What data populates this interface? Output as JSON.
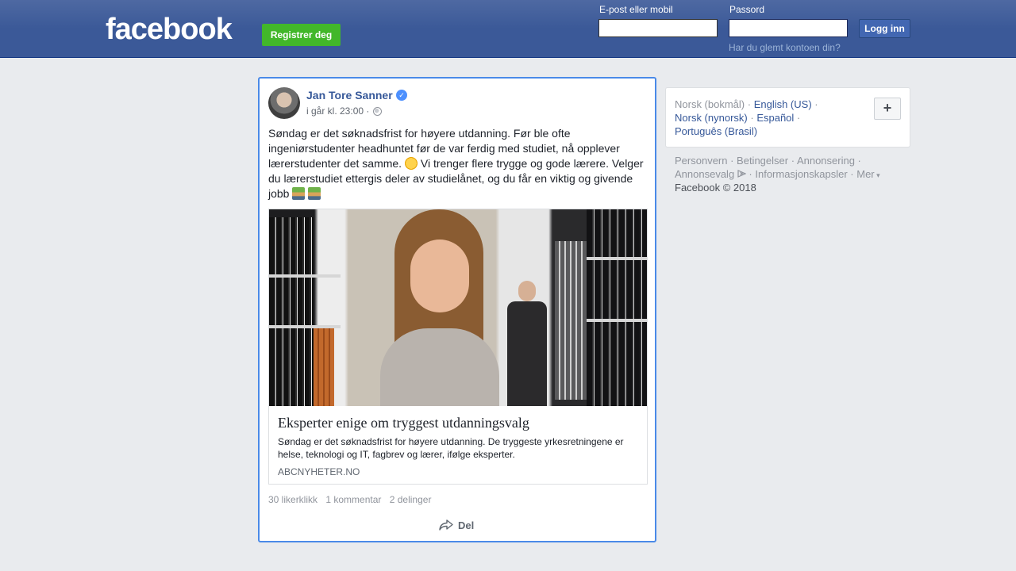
{
  "header": {
    "logo": "facebook",
    "register_label": "Registrer deg",
    "email_label": "E-post eller mobil",
    "password_label": "Passord",
    "login_label": "Logg inn",
    "forgot_label": "Har du glemt kontoen din?",
    "email_value": "",
    "password_value": ""
  },
  "post": {
    "author": "Jan Tore Sanner",
    "time": "i går kl. 23:00 ·",
    "text_part1": "Søndag er det søknadsfrist for høyere utdanning. Før ble ofte ingeniørstudenter headhuntet før de var ferdig med studiet, nå opplever lærerstudenter det samme.",
    "text_part2": "Vi trenger flere trygge og gode lærere. Velger du lærerstudiet ettergis deler av studielånet, og du får en viktig og givende jobb",
    "link": {
      "title": "Eksperter enige om tryggest utdanningsvalg",
      "description": "Søndag er det søknadsfrist for høyere utdanning. De tryggeste yrkesretningene er helse, teknologi og IT, fagbrev og lærer, ifølge eksperter.",
      "domain": "ABCNYHETER.NO"
    },
    "stats": {
      "likes": "30 likerklikk",
      "comments": "1 kommentar",
      "shares": "2 delinger"
    },
    "share_label": "Del"
  },
  "sidebar": {
    "languages": {
      "current": "Norsk (bokmål)",
      "items": [
        "English (US)",
        "Norsk (nynorsk)",
        "Español",
        "Português (Brasil)"
      ]
    },
    "footer_links": [
      "Personvern",
      "Betingelser",
      "Annonsering",
      "Annonsevalg",
      "Informasjonskapsler",
      "Mer"
    ],
    "copyright": "Facebook © 2018"
  },
  "icons": {
    "verified": "verified-badge-icon",
    "globe": "globe-icon",
    "share": "share-arrow-icon",
    "add": "plus-icon",
    "adchoices": "adchoices-icon"
  },
  "colors": {
    "brand_blue": "#3b5998",
    "link_blue": "#365899",
    "register_green": "#42b72a",
    "focus_border": "#4a8ae8"
  }
}
